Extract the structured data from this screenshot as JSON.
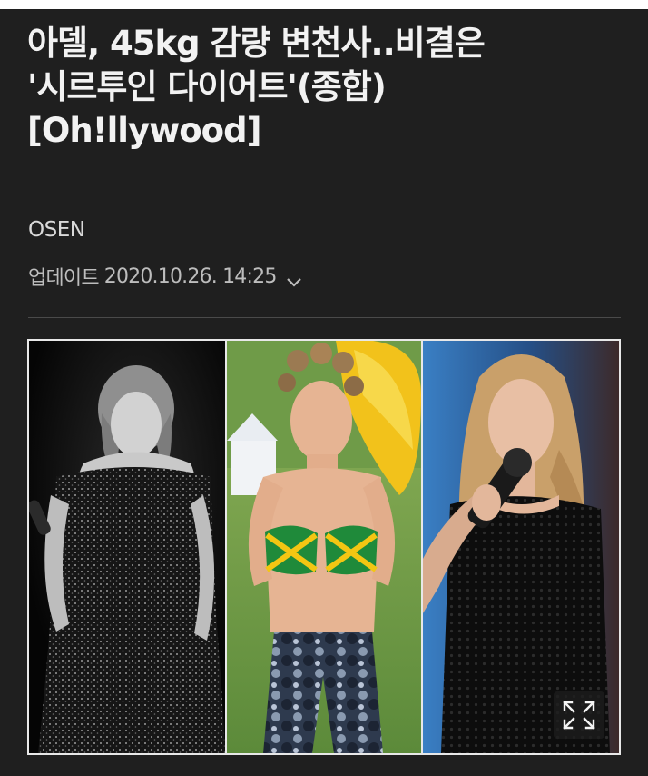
{
  "article": {
    "title_lines": [
      "아델, 45kg 감량 변천사..비결은",
      "'시르투인 다이어트'(종합)",
      "[Oh!llywood]"
    ],
    "source": "OSEN",
    "updated_label": "업데이트",
    "updated_datetime": "2020.10.26. 14:25"
  },
  "icons": {
    "updated_toggle": "chevron-down-icon",
    "photo_expand": "expand-icon"
  },
  "colors": {
    "background": "#1f1f1f",
    "title": "#f2f2f2",
    "meta": "#bdbdbd",
    "divider": "#4a4a4a"
  }
}
